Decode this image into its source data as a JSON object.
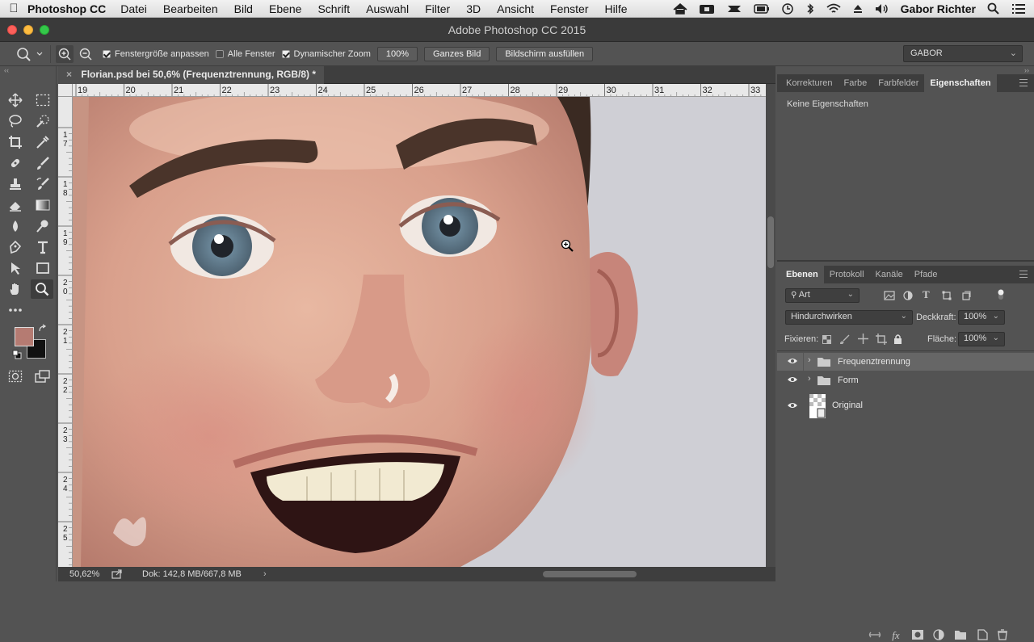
{
  "menubar": {
    "app_name": "Photoshop CC",
    "items": [
      "Datei",
      "Bearbeiten",
      "Bild",
      "Ebene",
      "Schrift",
      "Auswahl",
      "Filter",
      "3D",
      "Ansicht",
      "Fenster",
      "Hilfe"
    ],
    "user": "Gabor Richter"
  },
  "window": {
    "title": "Adobe Photoshop CC 2015"
  },
  "options": {
    "fit_window_label": "Fenstergröße anpassen",
    "all_windows_label": "Alle Fenster",
    "dynamic_zoom_label": "Dynamischer Zoom",
    "zoom_value": "100%",
    "fit_screen_label": "Ganzes Bild",
    "fill_screen_label": "Bildschirm ausfüllen",
    "workspace": "GABOR"
  },
  "document": {
    "tab_title": "Florian.psd bei 50,6% (Frequenztrennung, RGB/8) *",
    "ruler_h": [
      "19",
      "20",
      "21",
      "22",
      "23",
      "24",
      "25",
      "26",
      "27",
      "28",
      "29",
      "30",
      "31",
      "32",
      "33"
    ],
    "ruler_v": [
      "1 7",
      "1 8",
      "1 9",
      "2 0",
      "2 1",
      "2 2",
      "2 3",
      "2 4",
      "2 5"
    ],
    "zoom_status": "50,62%",
    "doc_status": "Dok: 142,8 MB/667,8 MB"
  },
  "tools": {
    "foreground_color": "#b57b72",
    "background_color": "#111111"
  },
  "properties_panel": {
    "tabs": [
      "Korrekturen",
      "Farbe",
      "Farbfelder",
      "Eigenschaften"
    ],
    "active_tab": "Eigenschaften",
    "empty_text": "Keine Eigenschaften"
  },
  "layers_panel": {
    "tabs": [
      "Ebenen",
      "Protokoll",
      "Kanäle",
      "Pfade"
    ],
    "active_tab": "Ebenen",
    "filter_kind": "Art",
    "blend_mode": "Hindurchwirken",
    "opacity_label": "Deckkraft:",
    "opacity_value": "100%",
    "lock_label": "Fixieren:",
    "fill_label": "Fläche:",
    "fill_value": "100%",
    "layers": [
      {
        "name": "Frequenztrennung",
        "type": "group",
        "selected": true
      },
      {
        "name": "Form",
        "type": "group",
        "selected": false
      },
      {
        "name": "Original",
        "type": "pixel",
        "selected": false
      }
    ]
  }
}
